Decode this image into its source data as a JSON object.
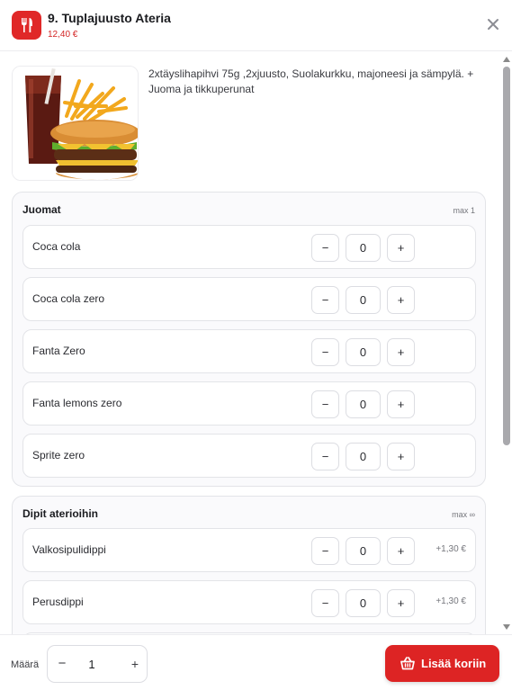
{
  "header": {
    "title": "9. Tuplajuusto Ateria",
    "price": "12,40 €",
    "icon": "restaurant-icon",
    "close_icon": "close-icon"
  },
  "product": {
    "image_icon": "burger-meal-photo",
    "description": "2xtäyslihapihvi 75g ,2xjuusto, Suolakurkku, majoneesi ja sämpylä. + Juoma ja tikkuperunat"
  },
  "groups": [
    {
      "title": "Juomat",
      "max": "max 1",
      "items": [
        {
          "name": "Coca cola",
          "minus": "−",
          "qty": "0",
          "plus": "+",
          "price": ""
        },
        {
          "name": "Coca cola zero",
          "minus": "−",
          "qty": "0",
          "plus": "+",
          "price": ""
        },
        {
          "name": "Fanta Zero",
          "minus": "−",
          "qty": "0",
          "plus": "+",
          "price": ""
        },
        {
          "name": "Fanta lemons zero",
          "minus": "−",
          "qty": "0",
          "plus": "+",
          "price": ""
        },
        {
          "name": "Sprite zero",
          "minus": "−",
          "qty": "0",
          "plus": "+",
          "price": ""
        }
      ]
    },
    {
      "title": "Dipit aterioihin",
      "max": "max ∞",
      "items": [
        {
          "name": "Valkosipulidippi",
          "minus": "−",
          "qty": "0",
          "plus": "+",
          "price": "+1,30 €"
        },
        {
          "name": "Perusdippi",
          "minus": "−",
          "qty": "0",
          "plus": "+",
          "price": "+1,30 €"
        }
      ]
    }
  ],
  "footer": {
    "quantity_label": "Määrä",
    "minus": "−",
    "quantity": "1",
    "plus": "+",
    "add_button": "Lisää koriin",
    "basket_icon": "basket-icon"
  },
  "colors": {
    "accent": "#dd2424",
    "price_red": "#d32626"
  }
}
